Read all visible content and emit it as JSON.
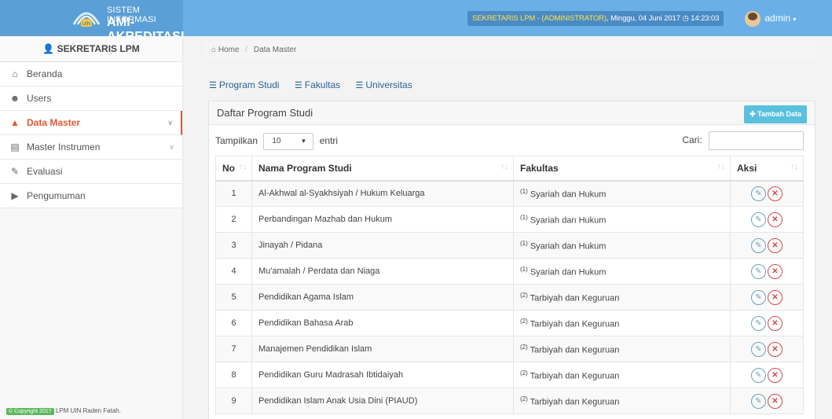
{
  "brand": {
    "top": "SISTEM INFORMASI",
    "main": "AMI-AKREDITASI",
    "logo_text": "UIN"
  },
  "header": {
    "role": "SEKRETARIS LPM - (ADMINISTRATOR)",
    "datetime": ", Minggu, 04 Juni 2017 ◷ 14:23:03",
    "user": "admin"
  },
  "sidebar": {
    "title": "👤 SEKRETARIS LPM",
    "items": [
      {
        "label": "Beranda",
        "icon": "home-icon"
      },
      {
        "label": "Users",
        "icon": "users-icon"
      },
      {
        "label": "Data Master",
        "icon": "folder-open-icon"
      },
      {
        "label": "Master Instrumen",
        "icon": "list-icon"
      },
      {
        "label": "Evaluasi",
        "icon": "edit-icon"
      },
      {
        "label": "Pengumuman",
        "icon": "bullhorn-icon"
      }
    ],
    "copyright_badge": "© Copyright 2017",
    "copyright_text": "LPM UIN Raden Fatah."
  },
  "breadcrumb": {
    "home": "Home",
    "current": "Data Master"
  },
  "tabs": [
    "Program Studi",
    "Fakultas",
    "Universitas"
  ],
  "panel": {
    "title": "Daftar Program Studi",
    "add_button": "Tambah Data",
    "show_label": "Tampilkan",
    "show_value": "10",
    "entries_label": "entri",
    "search_label": "Cari:"
  },
  "table": {
    "headers": [
      "No",
      "Nama Program Studi",
      "Fakultas",
      "Aksi"
    ],
    "rows": [
      {
        "no": "1",
        "prodi": "Al-Akhwal al-Syakhsiyah / Hukum Keluarga",
        "fak_no": "(1)",
        "fak": "Syariah dan Hukum"
      },
      {
        "no": "2",
        "prodi": "Perbandingan Mazhab dan Hukum",
        "fak_no": "(1)",
        "fak": "Syariah dan Hukum"
      },
      {
        "no": "3",
        "prodi": "Jinayah / Pidana",
        "fak_no": "(1)",
        "fak": "Syariah dan Hukum"
      },
      {
        "no": "4",
        "prodi": "Mu'amalah / Perdata dan Niaga",
        "fak_no": "(1)",
        "fak": "Syariah dan Hukum"
      },
      {
        "no": "5",
        "prodi": "Pendidikan Agama Islam",
        "fak_no": "(2)",
        "fak": "Tarbiyah dan Keguruan"
      },
      {
        "no": "6",
        "prodi": "Pendidikan Bahasa Arab",
        "fak_no": "(2)",
        "fak": "Tarbiyah dan Keguruan"
      },
      {
        "no": "7",
        "prodi": "Manajemen Pendidikan Islam",
        "fak_no": "(2)",
        "fak": "Tarbiyah dan Keguruan"
      },
      {
        "no": "8",
        "prodi": "Pendidikan Guru Madrasah Ibtidaiyah",
        "fak_no": "(2)",
        "fak": "Tarbiyah dan Keguruan"
      },
      {
        "no": "9",
        "prodi": "Pendidikan Islam Anak Usia Dini (PIAUD)",
        "fak_no": "(2)",
        "fak": "Tarbiyah dan Keguruan"
      }
    ]
  },
  "colors": {
    "topbar": "#6ab0e6",
    "active": "#e05a34",
    "add_button": "#5bc0de",
    "edit": "#6aa0c6",
    "delete": "#d84a4a"
  }
}
